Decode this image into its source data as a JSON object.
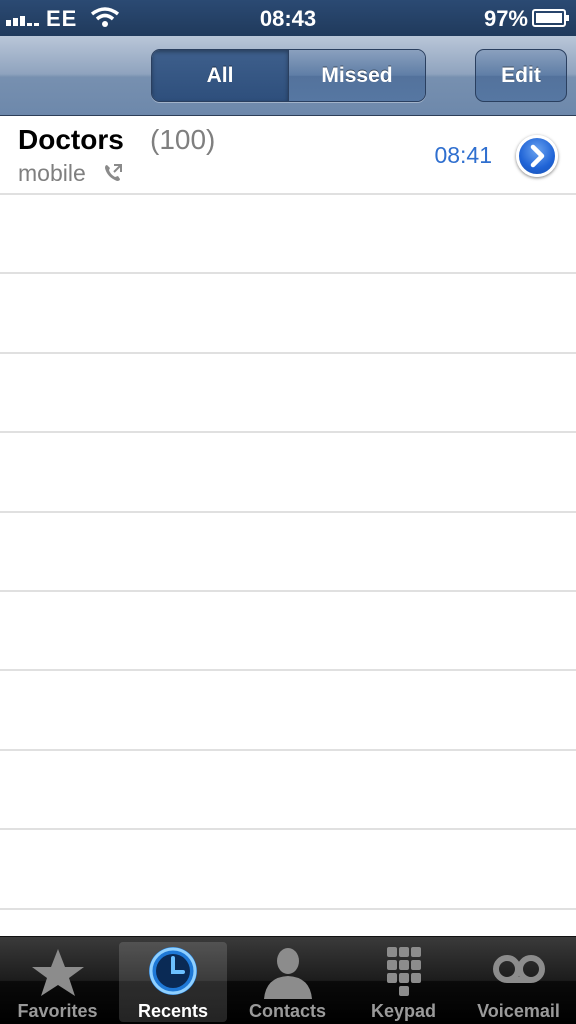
{
  "status_bar": {
    "carrier": "EE",
    "time": "08:43",
    "battery": "97%"
  },
  "nav": {
    "segments": [
      "All",
      "Missed"
    ],
    "selected_segment": "All",
    "edit_label": "Edit"
  },
  "calls": [
    {
      "name": "Doctors",
      "count": "(100)",
      "type": "mobile",
      "time": "08:41"
    }
  ],
  "tab_bar": {
    "tabs": [
      {
        "label": "Favorites",
        "icon": "star-icon"
      },
      {
        "label": "Recents",
        "icon": "clock-icon"
      },
      {
        "label": "Contacts",
        "icon": "person-icon"
      },
      {
        "label": "Keypad",
        "icon": "keypad-icon"
      },
      {
        "label": "Voicemail",
        "icon": "voicemail-icon"
      }
    ],
    "selected": "Recents"
  },
  "colors": {
    "accent_blue": "#2f6fcf",
    "nav_bar": "#7790b0"
  }
}
